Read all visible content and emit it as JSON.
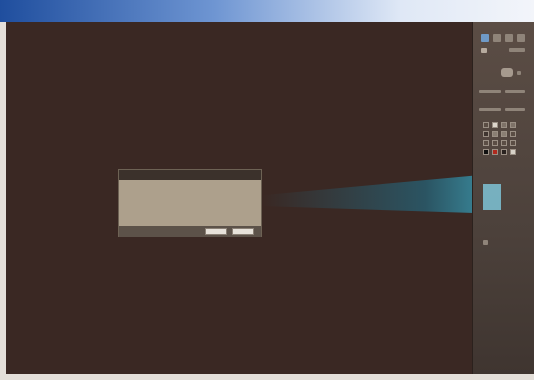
{
  "window": {
    "titlebar_colors": [
      "#1f4e9e",
      "#6e95d2",
      "#f3f5fa"
    ]
  },
  "canvas": {
    "background": "#3a2823"
  },
  "panel": {
    "header": "",
    "section_labels": [
      "",
      "",
      ""
    ],
    "tool_icons": [
      "cursor-icon",
      "brush-icon",
      "eraser-icon",
      "lasso-icon"
    ],
    "logo_text": "",
    "info_lines": [
      "",
      ""
    ]
  },
  "dialog": {
    "title": "",
    "lines": [
      "",
      "",
      "",
      "",
      "",
      ""
    ],
    "ok_label": "",
    "cancel_label": ""
  },
  "colors": {
    "dialog_bg": "#ada08c",
    "beam": "#46bed7",
    "logo": "#7fd14a"
  }
}
